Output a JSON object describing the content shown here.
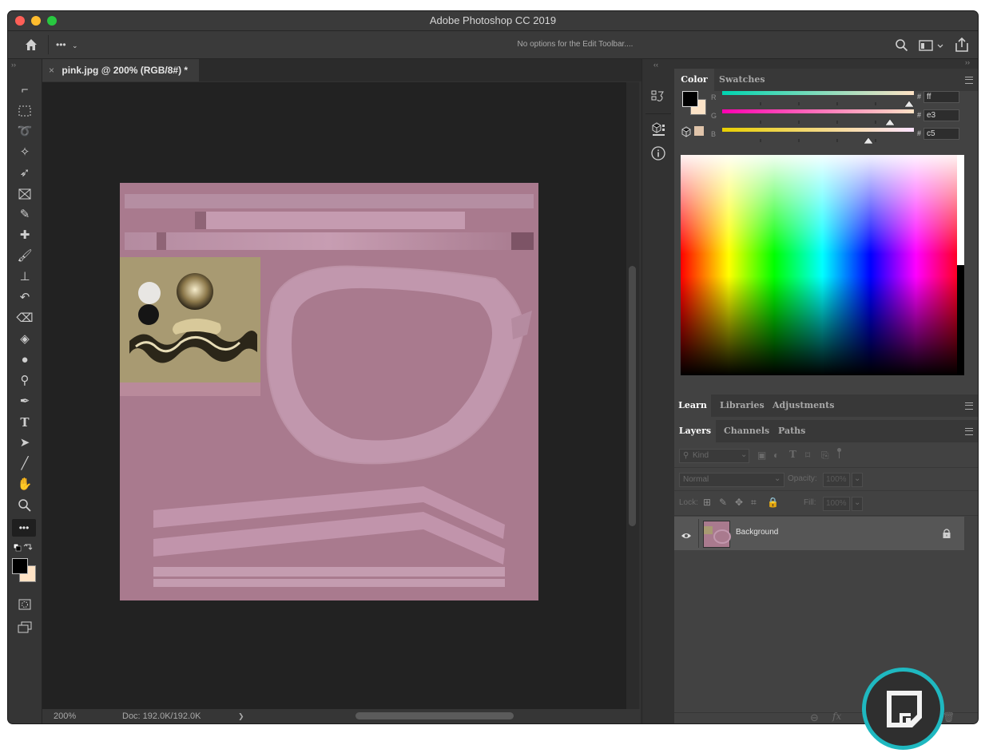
{
  "window": {
    "title": "Adobe Photoshop CC 2019"
  },
  "optionsbar": {
    "more_label": "•••",
    "message": "No options for the Edit Toolbar...."
  },
  "document": {
    "tab_title": "pink.jpg @ 200% (RGB/8#) *",
    "close_glyph": "×"
  },
  "status": {
    "zoom": "200%",
    "doc_info": "Doc: 192.0K/192.0K",
    "arrow": "❯"
  },
  "color_panel": {
    "tabs": [
      "Color",
      "Swatches"
    ],
    "channels": [
      {
        "label": "R",
        "hex": "ff",
        "level": 1.0
      },
      {
        "label": "G",
        "hex": "e3",
        "level": 0.89
      },
      {
        "label": "B",
        "hex": "c5",
        "level": 0.77
      }
    ],
    "hash": "#"
  },
  "learn_tabs": [
    "Learn",
    "Libraries",
    "Adjustments"
  ],
  "layers_panel": {
    "tabs": [
      "Layers",
      "Channels",
      "Paths"
    ],
    "filter_placeholder": "Kind",
    "blend_mode": "Normal",
    "opacity_label": "Opacity:",
    "opacity_value": "100%",
    "lock_label": "Lock:",
    "fill_label": "Fill:",
    "fill_value": "100%",
    "layers": [
      {
        "name": "Background",
        "visible": true,
        "locked": true
      }
    ],
    "footer_fx": "fx"
  },
  "toolbar_more_label": "•••",
  "colors": {
    "accent_teal": "#1fb8c0",
    "canvas_pink": "#a97a8e",
    "foreground": "#000000",
    "background_swatch": "#ffe3c5"
  }
}
